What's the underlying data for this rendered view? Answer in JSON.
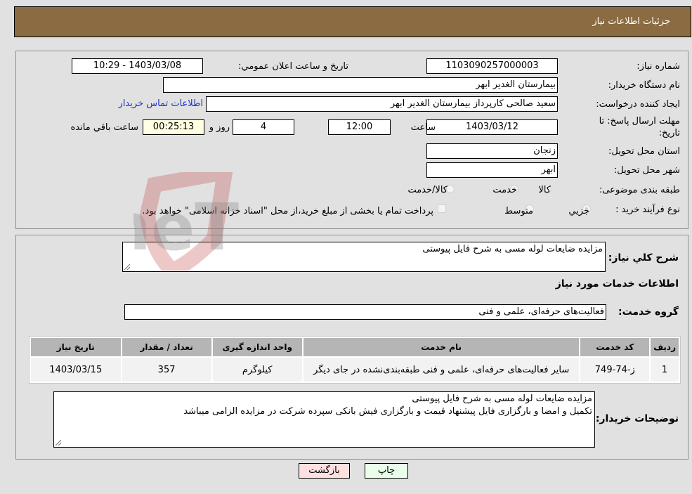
{
  "header": {
    "title": "جزئيات اطلاعات نیاز"
  },
  "details": {
    "need_number_label": "شماره نیاز:",
    "need_number": "1103090257000003",
    "announce_label": "تاریخ و ساعت اعلان عمومي:",
    "announce_value": "1403/03/08 - 10:29",
    "buyer_org_label": "نام دستگاه خریدار:",
    "buyer_org": "بیمارستان الغدیر ابهر",
    "creator_label": "ایجاد کننده درخواست:",
    "creator": "سعید صالحی کارپرداز بیمارستان الغدیر ابهر",
    "contact_link": "اطلاعات تماس خریدار",
    "deadline_label": "مهلت ارسال پاسخ: تا تاریخ:",
    "deadline_date": "1403/03/12",
    "time_label": "ساعت",
    "deadline_time": "12:00",
    "days_value": "4",
    "days_label": "روز و",
    "remaining_time": "00:25:13",
    "remaining_label": "ساعت باقي مانده",
    "province_label": "استان محل تحویل:",
    "province": "زنجان",
    "city_label": "شهر محل تحویل:",
    "city": "ابهر",
    "category_label": "طبقه بندی موضوعی:",
    "category_options": [
      {
        "label": "کالا",
        "selected": false
      },
      {
        "label": "خدمت",
        "selected": true
      },
      {
        "label": "کالا/خدمت",
        "selected": false
      }
    ],
    "purchase_type_label": "نوع فرآیند خرید :",
    "purchase_type_options": [
      {
        "label": "جزيي",
        "selected": true
      },
      {
        "label": "متوسط",
        "selected": false
      }
    ],
    "treasury_checkbox_label": "پرداخت تمام یا بخشی از مبلغ خرید،از محل \"اسناد خزانه اسلامی\" خواهد بود.",
    "treasury_checked": false
  },
  "services": {
    "summary_label": "شرح کلي نیاز:",
    "summary": "مزایده ضایعات لوله مسی به شرح فایل پیوستی",
    "section_title": "اطلاعات خدمات مورد نیاز",
    "group_label": "گروه خدمت:",
    "group": "فعالیت‌های حرفه‌ای، علمی و فنی",
    "table": {
      "headers": [
        "ردیف",
        "کد خدمت",
        "نام خدمت",
        "واحد اندازه گیری",
        "تعداد / مقدار",
        "تاریخ نیاز"
      ],
      "rows": [
        [
          "1",
          "ز-74-749",
          "سایر فعالیت‌های حرفه‌ای، علمی و فنی طبقه‌بندی‌نشده در جای دیگر",
          "کیلوگرم",
          "357",
          "1403/03/15"
        ]
      ]
    },
    "buyer_notes_label": "توضیحات خریدار:",
    "buyer_notes_line1": "مزایده ضایعات لوله مسی به شرح فایل پیوستی",
    "buyer_notes_line2": "تکمیل و امضا و بارگزاری فایل پیشنهاد قیمت و بارگزاری فیش بانکی سپرده شرکت در مزایده الزامی میباشد"
  },
  "buttons": {
    "print": "چاپ",
    "back": "بازگشت"
  },
  "colors": {
    "header_bg": "#8b6c42",
    "print_bg": "#eaffea",
    "back_bg": "#ffe0e0",
    "link": "#1a33cc"
  },
  "watermark": {
    "text": "AriaTender.neT"
  }
}
